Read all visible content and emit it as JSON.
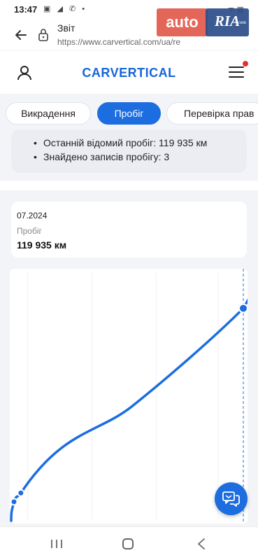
{
  "status_bar": {
    "time": "13:47",
    "icons": [
      "gallery-icon",
      "telegram-icon",
      "viber-icon",
      "dot-icon"
    ],
    "icons_text": "▣ ◢ ✆ •",
    "right_text": "ᯤ ▦"
  },
  "watermark": {
    "auto": "auto",
    "ria": "RIA",
    "com": ".com"
  },
  "browser": {
    "title": "Звіт",
    "url": "https://www.carvertical.com/ua/re"
  },
  "header": {
    "logo": "CARVERTICAL",
    "brand_color": "#1666d8"
  },
  "tabs": [
    {
      "label": "Викрадення"
    },
    {
      "label": "Пробіг",
      "active": true
    },
    {
      "label": "Перевірка прав"
    }
  ],
  "summary": {
    "items": [
      {
        "text": "Останній відомий пробіг: 119 935 км"
      },
      {
        "text": "Знайдено записів пробігу: 3"
      }
    ]
  },
  "data_card": {
    "date": "07.2024",
    "label": "Пробіг",
    "value": "119 935 км"
  },
  "chart_data": {
    "type": "line",
    "title": "",
    "xlabel": "",
    "ylabel": "",
    "grid": true,
    "series": [
      {
        "color": "#1b6de0",
        "x": [
          0,
          0.03,
          1.0
        ],
        "y": [
          10000,
          15000,
          119935
        ]
      }
    ],
    "x_range": [
      0,
      1
    ],
    "y_range": [
      0,
      140000
    ],
    "highlighted_point": {
      "x": 1.0,
      "y": 119935
    }
  },
  "chat": {
    "icon": "chat-icon"
  },
  "nav": {
    "recent": "recent-apps-icon",
    "home": "home-icon",
    "back": "back-icon"
  }
}
